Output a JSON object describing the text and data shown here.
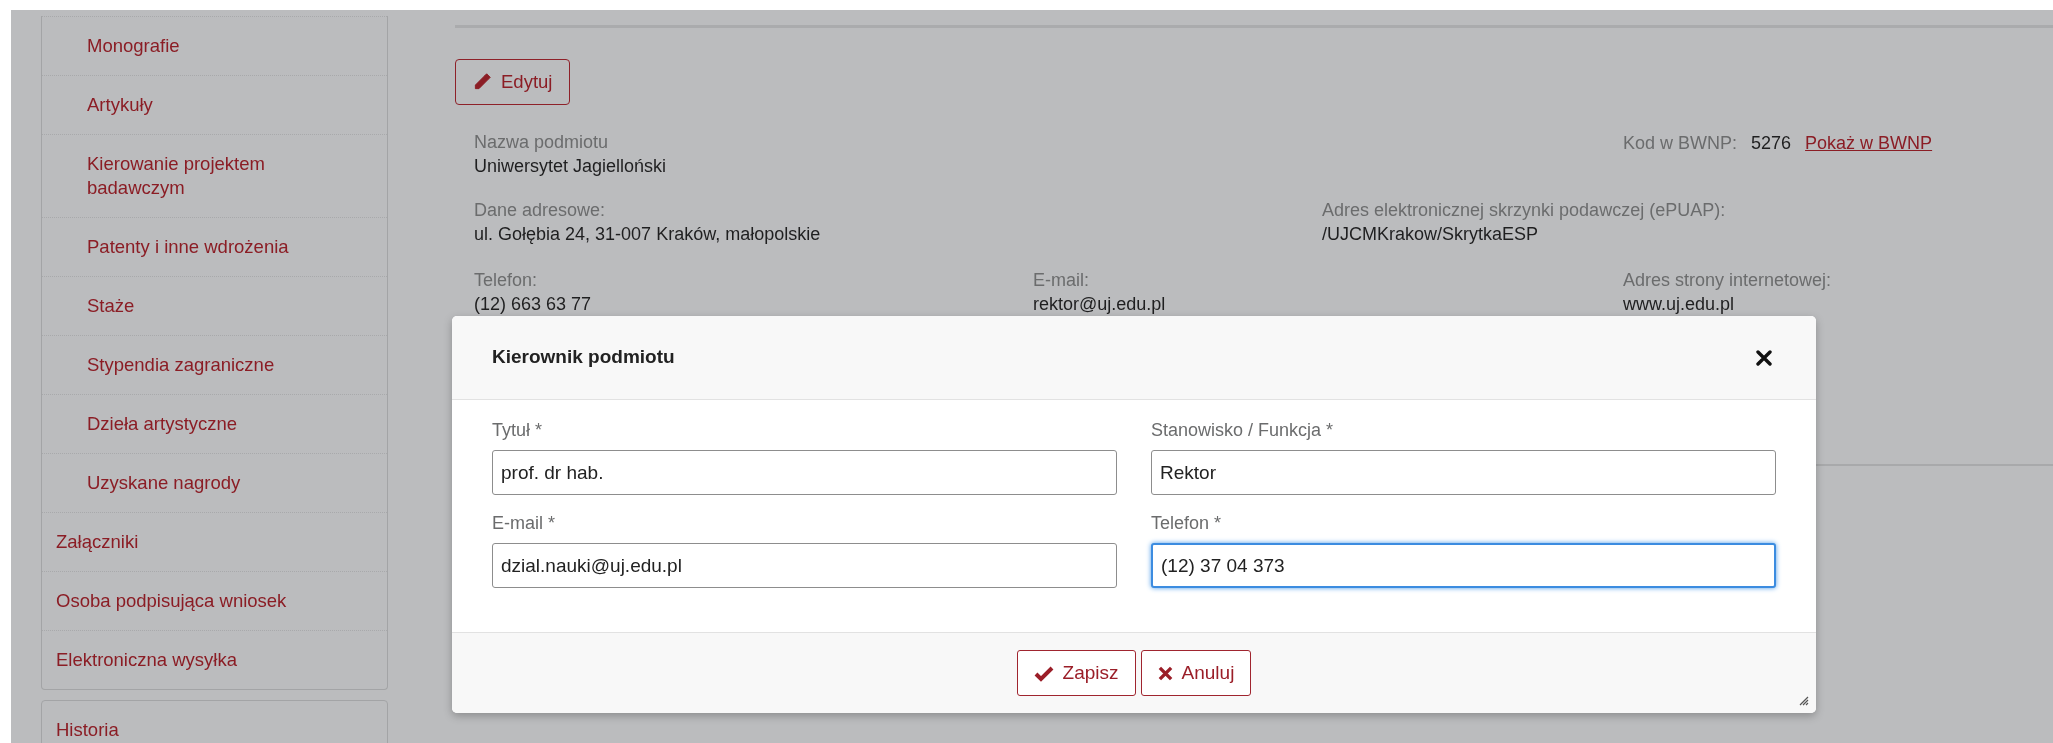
{
  "sidebar": {
    "subitems": [
      {
        "label": "Monografie"
      },
      {
        "label": "Artykuły"
      },
      {
        "label": "Kierowanie projektem badawczym"
      },
      {
        "label": "Patenty i inne wdrożenia"
      },
      {
        "label": "Staże"
      },
      {
        "label": "Stypendia zagraniczne"
      },
      {
        "label": "Dzieła artystyczne"
      },
      {
        "label": "Uzyskane nagrody"
      }
    ],
    "items": [
      {
        "label": "Załączniki"
      },
      {
        "label": "Osoba podpisująca wniosek"
      },
      {
        "label": "Elektroniczna wysyłka"
      }
    ],
    "history": {
      "label": "Historia"
    }
  },
  "edit_button": {
    "label": "Edytuj"
  },
  "entity": {
    "name": {
      "label": "Nazwa podmiotu",
      "value": "Uniwersytet Jagielloński"
    },
    "bwnp": {
      "label": "Kod w BWNP:",
      "value": "5276",
      "link": "Pokaż w BWNP"
    },
    "address": {
      "label": "Dane adresowe:",
      "value": "ul. Gołębia 24, 31-007 Kraków, małopolskie"
    },
    "epuap": {
      "label": "Adres elektronicznej skrzynki podawczej (ePUAP):",
      "value": "/UJCMKrakow/SkrytkaESP"
    },
    "contacts": [
      {
        "label": "Telefon:",
        "value": "(12) 663 63 77"
      },
      {
        "label": "E-mail:",
        "value": "rektor@uj.edu.pl"
      },
      {
        "label": "Adres strony internetowej:",
        "value": "www.uj.edu.pl"
      }
    ]
  },
  "modal": {
    "title": "Kierownik podmiotu",
    "fields": [
      {
        "label": "Tytuł *",
        "value": "prof. dr hab.",
        "focused": false
      },
      {
        "label": "Stanowisko / Funkcja *",
        "value": "Rektor",
        "focused": false
      },
      {
        "label": "E-mail *",
        "value": "dzial.nauki@uj.edu.pl",
        "focused": false
      },
      {
        "label": "Telefon *",
        "value": "(12) 37 04 373",
        "focused": true
      }
    ],
    "buttons": [
      {
        "kind": "save",
        "label": "Zapisz"
      },
      {
        "kind": "cancel",
        "label": "Anuluj"
      }
    ]
  }
}
